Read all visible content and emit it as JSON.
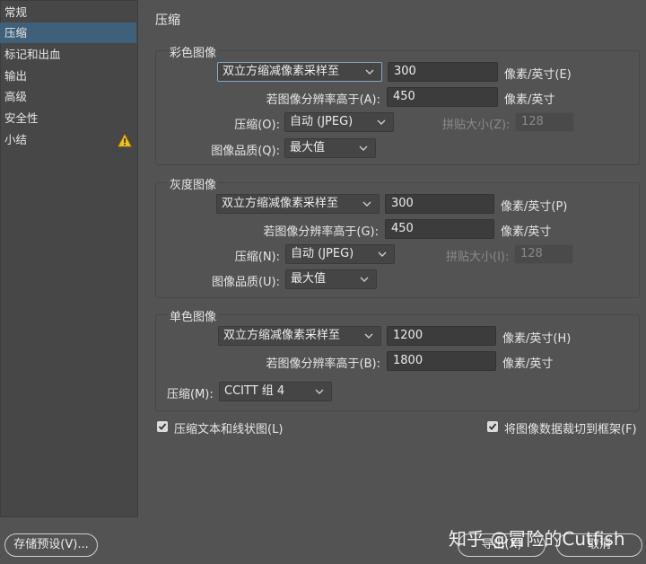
{
  "sidebar": {
    "items": [
      {
        "label": "常规"
      },
      {
        "label": "压缩"
      },
      {
        "label": "标记和出血"
      },
      {
        "label": "输出"
      },
      {
        "label": "高级"
      },
      {
        "label": "安全性"
      },
      {
        "label": "小结"
      }
    ],
    "selected_index": 1,
    "warning_item_index": 6
  },
  "page_title": "压缩",
  "color_images": {
    "legend": "彩色图像",
    "downsample": "双立方缩减像素采样至",
    "ppi_value": "300",
    "ppi_unit": "像素/英寸(E)",
    "above_label": "若图像分辨率高于(A):",
    "above_value": "450",
    "above_unit": "像素/英寸",
    "compression_label": "压缩(O):",
    "compression_value": "自动 (JPEG)",
    "tile_label": "拼贴大小(Z):",
    "tile_value": "128",
    "quality_label": "图像品质(Q):",
    "quality_value": "最大值"
  },
  "gray_images": {
    "legend": "灰度图像",
    "downsample": "双立方缩减像素采样至",
    "ppi_value": "300",
    "ppi_unit": "像素/英寸(P)",
    "above_label": "若图像分辨率高于(G):",
    "above_value": "450",
    "above_unit": "像素/英寸",
    "compression_label": "压缩(N):",
    "compression_value": "自动 (JPEG)",
    "tile_label": "拼贴大小(I):",
    "tile_value": "128",
    "quality_label": "图像品质(U):",
    "quality_value": "最大值"
  },
  "mono_images": {
    "legend": "单色图像",
    "downsample": "双立方缩减像素采样至",
    "ppi_value": "1200",
    "ppi_unit": "像素/英寸(H)",
    "above_label": "若图像分辨率高于(B):",
    "above_value": "1800",
    "above_unit": "像素/英寸",
    "compression_label": "压缩(M):",
    "compression_value": "CCITT 组 4"
  },
  "options": {
    "compress_text_label": "压缩文本和线状图(L)",
    "compress_text_checked": true,
    "crop_image_label": "将图像数据裁切到框架(F)",
    "crop_image_checked": true
  },
  "buttons": {
    "save_preset": "存储预设(V)...",
    "export": "导出(X)",
    "cancel": "取消"
  },
  "watermark": "知乎 @冒险的Cutfish",
  "colors": {
    "background": "#535353",
    "sidebar_bg": "#474747",
    "selected_bg": "#3f607a",
    "warning": "#f5c518"
  }
}
